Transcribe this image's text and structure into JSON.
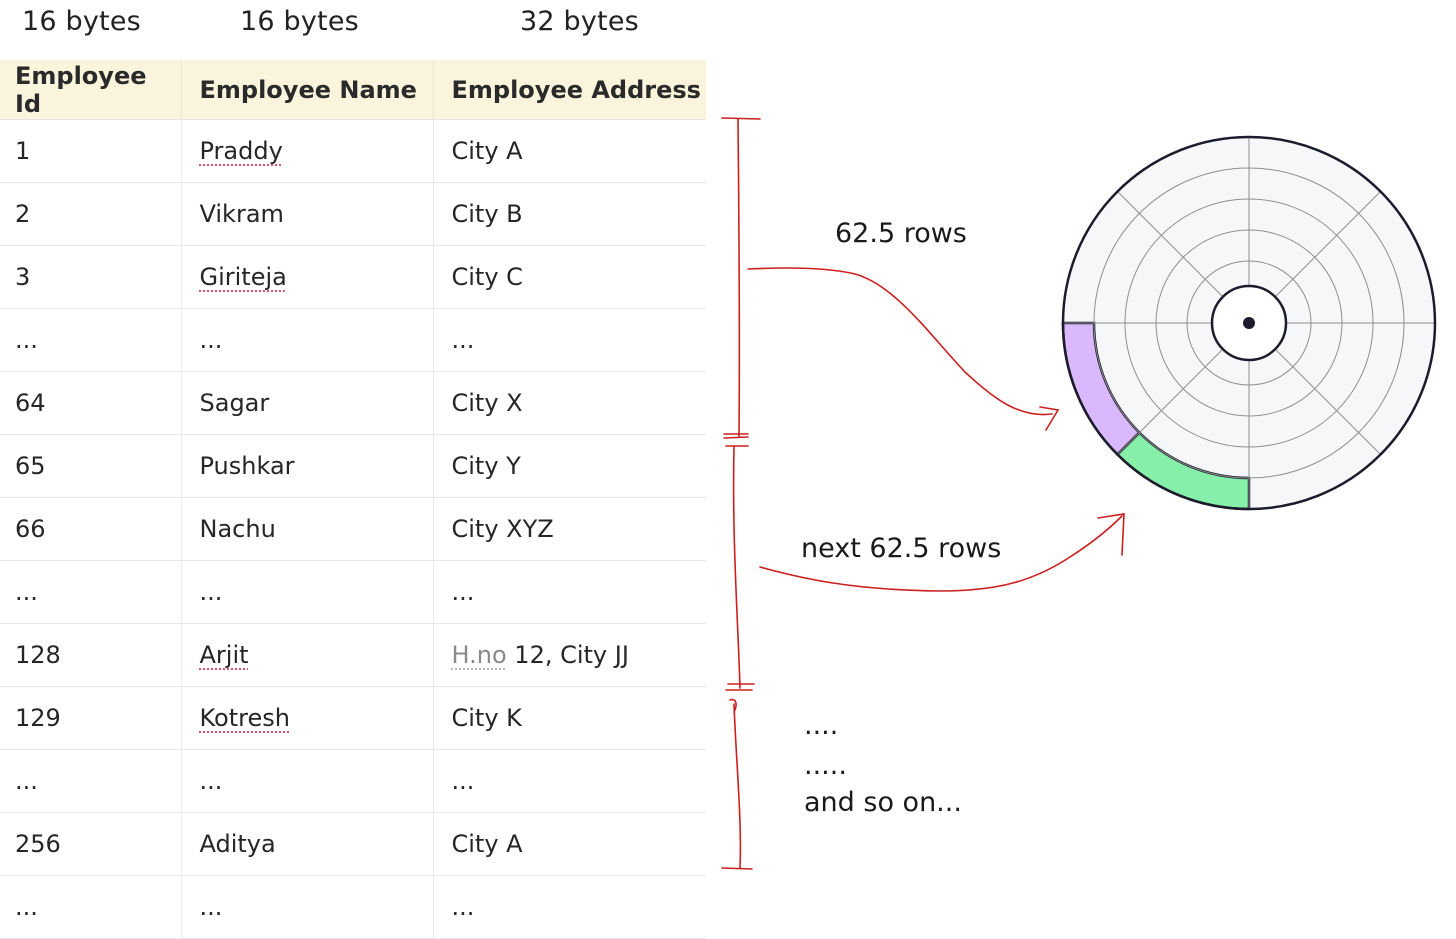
{
  "column_sizes": [
    "16 bytes",
    "16 bytes",
    "32 bytes"
  ],
  "table": {
    "headers": [
      "Employee Id",
      "Employee Name",
      "Employee Address"
    ],
    "rows": [
      {
        "id": "1",
        "name": "Praddy",
        "address": "City A",
        "name_flagged": true
      },
      {
        "id": "2",
        "name": "Vikram",
        "address": "City B"
      },
      {
        "id": "3",
        "name": "Giriteja",
        "address": "City C",
        "name_flagged": true
      },
      {
        "id": "...",
        "name": "...",
        "address": "..."
      },
      {
        "id": "64",
        "name": "Sagar",
        "address": "City X"
      },
      {
        "id": "65",
        "name": "Pushkar",
        "address": "City Y"
      },
      {
        "id": "66",
        "name": "Nachu",
        "address": "City XYZ"
      },
      {
        "id": "...",
        "name": "...",
        "address": "..."
      },
      {
        "id": "128",
        "name": "Arjit",
        "address_prefix": "H.no",
        "address": "12, City JJ",
        "name_flagged": true
      },
      {
        "id": "129",
        "name": "Kotresh",
        "address": "City K",
        "name_flagged": true
      },
      {
        "id": "...",
        "name": "...",
        "address": "..."
      },
      {
        "id": "256",
        "name": "Aditya",
        "address": "City A"
      },
      {
        "id": "...",
        "name": "...",
        "address": "..."
      }
    ]
  },
  "annotations": {
    "first_group": "62.5 rows",
    "second_group": "next 62.5 rows",
    "continuation": [
      "....",
      ".....",
      "and so on..."
    ]
  },
  "disk": {
    "block_1_color": "#d9b8fb",
    "block_2_color": "#86f0aa"
  },
  "colors": {
    "header_bg": "#fbf4dc",
    "annotation_red": "#cc1f1f"
  }
}
